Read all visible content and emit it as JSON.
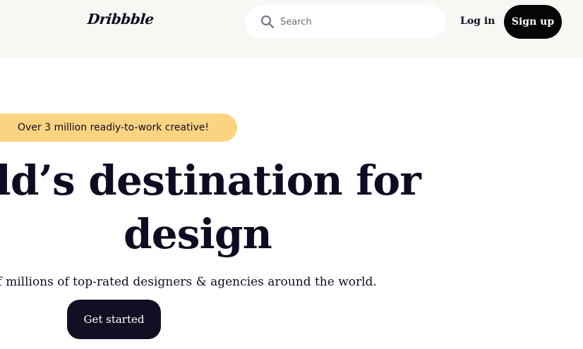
{
  "header": {
    "logo_text": "Dribbble",
    "search": {
      "placeholder": "Search",
      "value": ""
    },
    "login_label": "Log in",
    "signup_label": "Sign up"
  },
  "hero": {
    "badge_text": "Over 3 million readiy-to-work creative!",
    "headline_line1": "rld’s destination for",
    "headline_line2": "design",
    "subline": "of millions of top-rated designers & agencies around the world.",
    "cta_label": "Get started"
  },
  "colors": {
    "header_bg": "#f8f7f4",
    "badge_bg": "#fcd381",
    "signup_bg": "#050505",
    "cta_bg": "#110f23",
    "text": "#0d0c22"
  },
  "icons": {
    "search": "search-icon"
  }
}
